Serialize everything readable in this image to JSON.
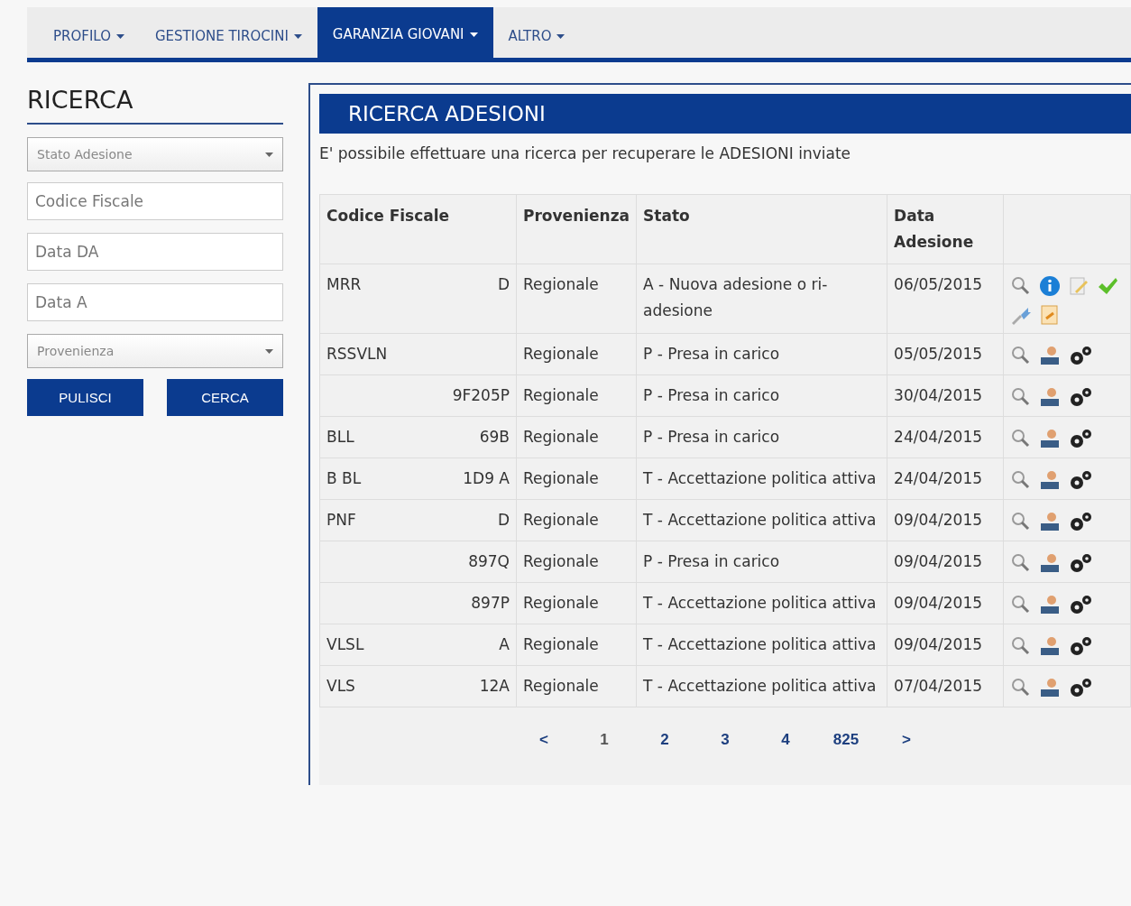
{
  "nav": [
    {
      "label": "PROFILO",
      "selected": false
    },
    {
      "label": "GESTIONE TIROCINI",
      "selected": false
    },
    {
      "label": "GARANZIA GIOVANI",
      "selected": true
    },
    {
      "label": "ALTRO",
      "selected": false
    }
  ],
  "sidebar": {
    "title": "RICERCA",
    "fields": [
      {
        "kind": "select",
        "placeholder": "Stato Adesione"
      },
      {
        "kind": "input",
        "placeholder": "Codice Fiscale"
      },
      {
        "kind": "input",
        "placeholder": "Data DA"
      },
      {
        "kind": "input",
        "placeholder": "Data A"
      },
      {
        "kind": "select",
        "placeholder": "Provenienza"
      }
    ],
    "buttons": [
      "PULISCI",
      "CERCA"
    ]
  },
  "panel": {
    "title": "RICERCA ADESIONI",
    "description": "E' possibile effettuare una ricerca per recuperare le ADESIONI inviate",
    "table": {
      "columns": [
        "Codice Fiscale",
        "Provenienza",
        "Stato",
        "Data Adesione"
      ],
      "rows": [
        {
          "code_left": "MRR",
          "code_right": "D",
          "origin": "Regionale",
          "status": "A - Nuova adesione o ri-adesione",
          "date": "06/05/2015",
          "kind": "new"
        },
        {
          "code_left": "RSSVLN",
          "code_right": "",
          "origin": "Regionale",
          "status": "P - Presa in carico",
          "date": "05/05/2015",
          "kind": "managed"
        },
        {
          "code_left": "",
          "code_right": "9F205P",
          "origin": "Regionale",
          "status": "P - Presa in carico",
          "date": "30/04/2015",
          "kind": "managed"
        },
        {
          "code_left": "BLL",
          "code_right": "69B",
          "origin": "Regionale",
          "status": "P - Presa in carico",
          "date": "24/04/2015",
          "kind": "managed"
        },
        {
          "code_left": "B BL",
          "code_right": "1D9 A",
          "origin": "Regionale",
          "status": "T - Accettazione politica attiva",
          "date": "24/04/2015",
          "kind": "managed"
        },
        {
          "code_left": "PNF",
          "code_right": "D",
          "origin": "Regionale",
          "status": "T - Accettazione politica attiva",
          "date": "09/04/2015",
          "kind": "managed"
        },
        {
          "code_left": "",
          "code_right": "897Q",
          "origin": "Regionale",
          "status": "P - Presa in carico",
          "date": "09/04/2015",
          "kind": "managed"
        },
        {
          "code_left": "",
          "code_right": "897P",
          "origin": "Regionale",
          "status": "T - Accettazione politica attiva",
          "date": "09/04/2015",
          "kind": "managed"
        },
        {
          "code_left": "VLSL",
          "code_right": "A",
          "origin": "Regionale",
          "status": "T - Accettazione politica attiva",
          "date": "09/04/2015",
          "kind": "managed"
        },
        {
          "code_left": "VLS",
          "code_right": "12A",
          "origin": "Regionale",
          "status": "T - Accettazione politica attiva",
          "date": "07/04/2015",
          "kind": "managed"
        }
      ]
    },
    "pagination": [
      {
        "label": "<",
        "selected": false
      },
      {
        "label": "1",
        "selected": true
      },
      {
        "label": "2",
        "selected": false
      },
      {
        "label": "3",
        "selected": false
      },
      {
        "label": "4",
        "selected": false
      },
      {
        "label": "825",
        "selected": false
      },
      {
        "label": ">",
        "selected": false
      }
    ]
  }
}
